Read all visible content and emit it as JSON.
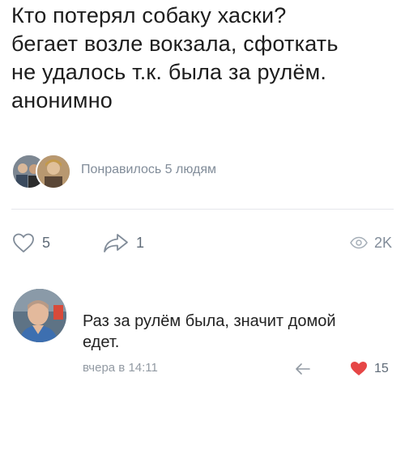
{
  "post": {
    "lines": [
      "Кто потерял собаку хаски?",
      "бегает возле вокзала, сфоткать",
      "не удалось т.к. была за рулём.",
      "анонимно"
    ]
  },
  "likes": {
    "text": "Понравилось 5 людям",
    "count": "5"
  },
  "shares": {
    "count": "1"
  },
  "views": {
    "count": "2K"
  },
  "comment": {
    "lines": [
      "Раз за рулём была, значит домой",
      "едет."
    ],
    "time": "вчера в 14:11",
    "likes": "15",
    "like_color": "#e64646"
  },
  "icons": {
    "like": "heart-outline-icon",
    "share": "share-arrow-icon",
    "views": "eye-icon",
    "reply": "reply-arrow-icon",
    "comment_like": "heart-filled-icon"
  }
}
